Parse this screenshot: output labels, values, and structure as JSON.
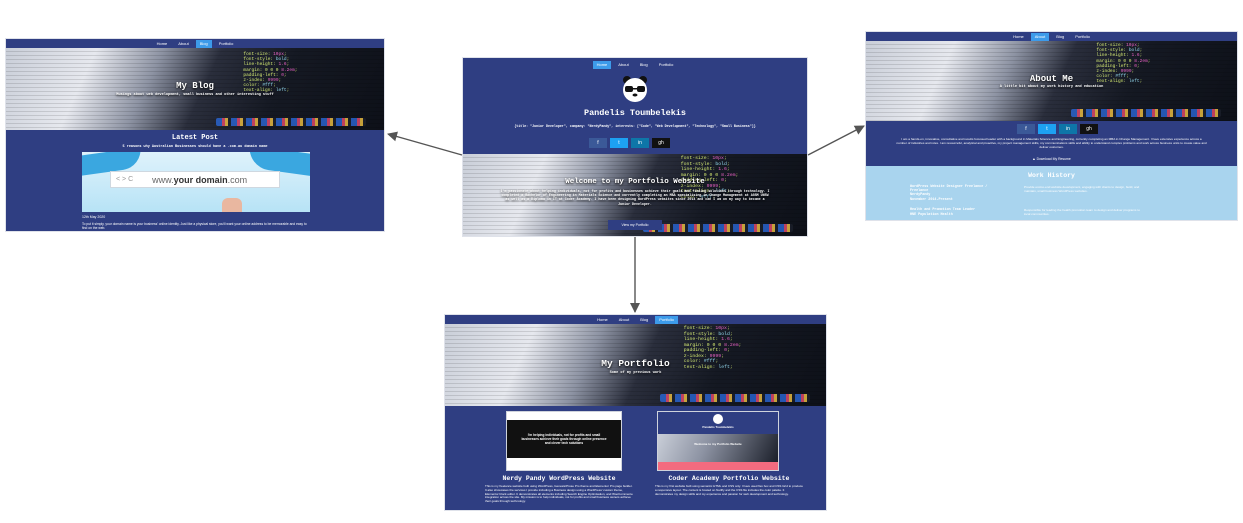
{
  "nav": {
    "home": "Home",
    "about": "About",
    "blog": "Blog",
    "portfolio": "Portfolio"
  },
  "home": {
    "name": "Pandelis Toumbelekis",
    "tagline": "{title: \"Junior Developer\", company: \"NerdyPandy\", interests: [\"Code\", \"Web Development\", \"Technology\", \"Small Business\"]}",
    "welcome": "Welcome to my Portfolio Website",
    "intro": "I'm passionate about helping individuals, not for profits and businesses achieve their goals and finding solutions through technology. I completed a Bachelor of Engineering in Materials Science and currently completing an MBA specialising in Change Management at AGSM UNSW as well as a Diploma in IT at Coder Academy. I have been designing WordPress websites since 2014 and can I am on my way to become a Junior Developer.",
    "button": "View my Portfolio",
    "social": [
      "f",
      "t",
      "in",
      "gh"
    ]
  },
  "blog": {
    "title": "My Blog",
    "subtitle": "Musings about web development, small business and other interesting stuff",
    "latest": "Latest Post",
    "post_title": "5 reasons why Australian Businesses should have a .com.au domain name",
    "domain_text": "www.your domain.com",
    "domain_prefix": "www.",
    "domain_bold": "your domain",
    "domain_suffix": ".com",
    "date": "12th May 2020",
    "excerpt": "To put it simply, your domain name is your business' online identity. Just like a physical store, you'll want your online address to be memorable and easy to find on the web."
  },
  "about": {
    "title": "About Me",
    "subtitle": "A little bit about my work history and education",
    "social": [
      "f",
      "t",
      "in",
      "gh"
    ],
    "paragraph": "I am a hands-on, innovative, consultative and results focussed leader with a background in Materials Science and Engineering, currently completing an MBA in Change Management. I have extensive experience across a number of industries and roles. I am resourceful, analytical and proactive, my project management skills, my communications skills and ability to understand complex problems and work across business units to create value and deliver outcomes.",
    "download": "Download My Resume",
    "work_history": "Work History",
    "jobs": [
      {
        "title": "WordPress Website Designer Freelance / Freelance",
        "company": "NerdyPandy",
        "dates": "November 2014-Present",
        "desc": "Provide end-to-end website development, engaging with clients to design, build, and maintain, small business WordPress websites."
      },
      {
        "title": "Health and Promotion Team Leader",
        "company": "HNE Population Health",
        "dates": "",
        "desc": "Responsible for leading the health promotion team to design and deliver programs to local communities."
      }
    ]
  },
  "portfolio": {
    "title": "My Portfolio",
    "subtitle": "Some of my previous work",
    "projects": [
      {
        "title": "Nerdy Pandy WordPress Website",
        "thumb_text": "I'm helping individuals, not for profits and small businesses achieve their goals through online presence and clever tech solutions",
        "desc": "This is my freelance website built using WordPress, Genesis/Prose Pro theme and Elementor Pro page builder. It also showcases the services I provide including a Business design using a WordPress' custom theme, Elementor block editor. It demonstrates all elements including Search Engine Optimisation, and WooCommerce integration across the site. My mission is to help individuals, not for profits and small business owners achieve their goals through technology."
      },
      {
        "title": "Coder Academy Portfolio Website",
        "thumb_text": "Pandelis Toumbelekis",
        "thumb_text2": "Welcome to my Portfolio Website",
        "desc": "This is my first website built using semantic HTML and CSS only. I have used flex box and CSS Grid to produce a responsive layout. The content is hosted on Netlify and the CSS file includes the color palette. It demonstrates my design skills and my experience and passion for web development and technology."
      }
    ]
  },
  "colors": {
    "navy": "#2f3e82",
    "accent": "#3d9bea",
    "light_blue": "#a9d4ee",
    "arrow": "#555555"
  }
}
